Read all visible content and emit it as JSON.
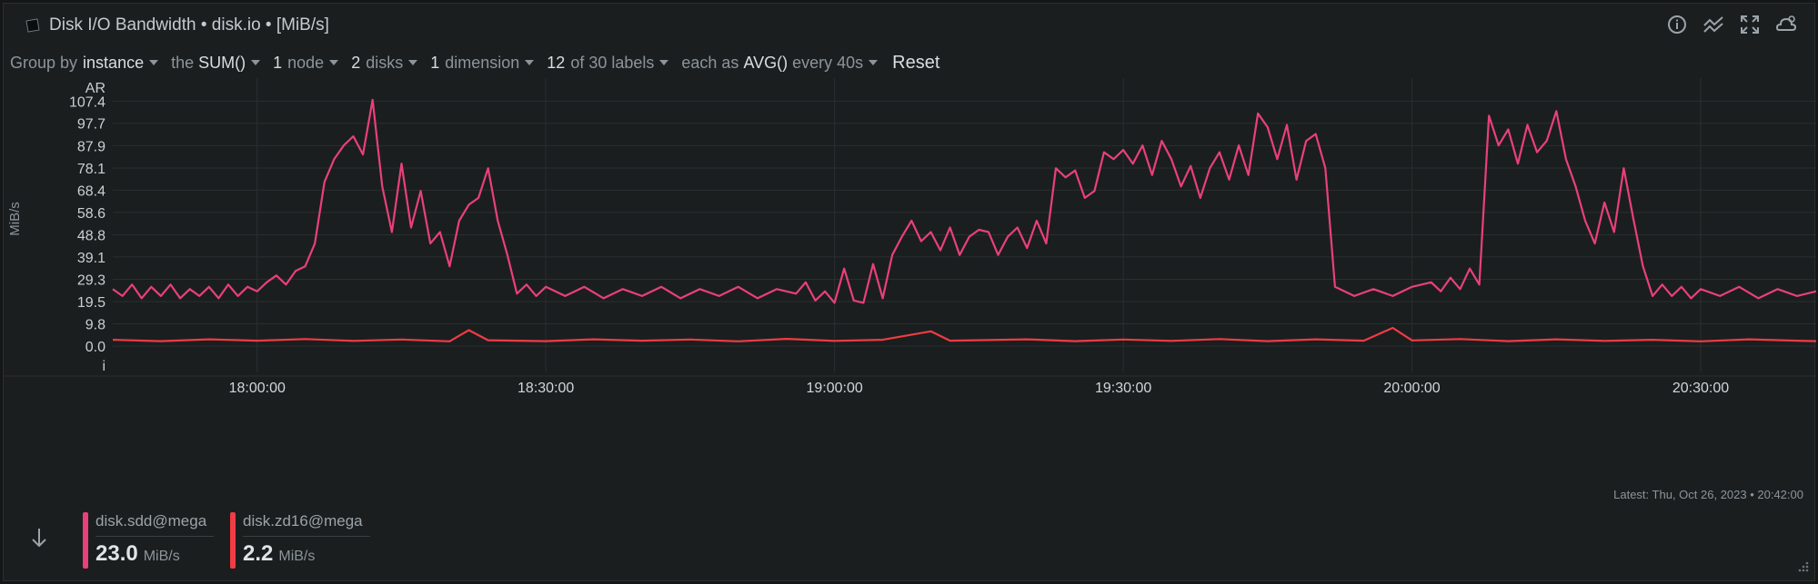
{
  "header": {
    "title": "Disk I/O Bandwidth • disk.io • [MiB/s]",
    "icons": [
      "hdd-icon",
      "info-icon",
      "chart-type-icon",
      "fullscreen-icon",
      "alert-icon"
    ]
  },
  "controls": {
    "group_by_label": "Group by",
    "group_by_value": "instance",
    "the_label": "the",
    "aggregate": "SUM()",
    "nodes_count": "1",
    "nodes_label": "node",
    "disks_count": "2",
    "disks_label": "disks",
    "dimension_count": "1",
    "dimension_label": "dimension",
    "labels_count": "12",
    "labels_of": "of 30 labels",
    "each_as_label": "each as",
    "each_as_value": "AVG()",
    "every": "every 40s",
    "reset": "Reset"
  },
  "chart_data": {
    "type": "line",
    "ylabel": "MiB/s",
    "yticks": [
      "107.4",
      "97.7",
      "87.9",
      "78.1",
      "68.4",
      "58.6",
      "48.8",
      "39.1",
      "29.3",
      "19.5",
      "9.8",
      "0.0"
    ],
    "ytop_label": "AR",
    "ybottom_label": "i",
    "ylim": [
      -11.5,
      117.5
    ],
    "xlim": [
      "17:45:00",
      "20:42:00"
    ],
    "xticks": [
      "18:00:00",
      "18:30:00",
      "19:00:00",
      "19:30:00",
      "20:00:00",
      "20:30:00"
    ],
    "grid": true,
    "series": [
      {
        "name": "disk.sdd@mega",
        "color": "#e9407a",
        "points": [
          [
            "17:45:00",
            25
          ],
          [
            "17:46:00",
            22
          ],
          [
            "17:47:00",
            27
          ],
          [
            "17:48:00",
            21
          ],
          [
            "17:49:00",
            26
          ],
          [
            "17:50:00",
            22
          ],
          [
            "17:51:00",
            27
          ],
          [
            "17:52:00",
            21
          ],
          [
            "17:53:00",
            25
          ],
          [
            "17:54:00",
            22
          ],
          [
            "17:55:00",
            26
          ],
          [
            "17:56:00",
            21
          ],
          [
            "17:57:00",
            27
          ],
          [
            "17:58:00",
            22
          ],
          [
            "17:59:00",
            26
          ],
          [
            "18:00:00",
            24
          ],
          [
            "18:01:00",
            28
          ],
          [
            "18:02:00",
            31
          ],
          [
            "18:03:00",
            27
          ],
          [
            "18:04:00",
            33
          ],
          [
            "18:05:00",
            35
          ],
          [
            "18:06:00",
            45
          ],
          [
            "18:07:00",
            72
          ],
          [
            "18:08:00",
            82
          ],
          [
            "18:09:00",
            88
          ],
          [
            "18:10:00",
            92
          ],
          [
            "18:11:00",
            84
          ],
          [
            "18:12:00",
            108
          ],
          [
            "18:13:00",
            70
          ],
          [
            "18:14:00",
            50
          ],
          [
            "18:15:00",
            80
          ],
          [
            "18:16:00",
            52
          ],
          [
            "18:17:00",
            68
          ],
          [
            "18:18:00",
            45
          ],
          [
            "18:19:00",
            50
          ],
          [
            "18:20:00",
            35
          ],
          [
            "18:21:00",
            55
          ],
          [
            "18:22:00",
            62
          ],
          [
            "18:23:00",
            65
          ],
          [
            "18:24:00",
            78
          ],
          [
            "18:25:00",
            55
          ],
          [
            "18:26:00",
            40
          ],
          [
            "18:27:00",
            23
          ],
          [
            "18:28:00",
            27
          ],
          [
            "18:29:00",
            22
          ],
          [
            "18:30:00",
            26
          ],
          [
            "18:32:00",
            22
          ],
          [
            "18:34:00",
            26
          ],
          [
            "18:36:00",
            21
          ],
          [
            "18:38:00",
            25
          ],
          [
            "18:40:00",
            22
          ],
          [
            "18:42:00",
            26
          ],
          [
            "18:44:00",
            21
          ],
          [
            "18:46:00",
            25
          ],
          [
            "18:48:00",
            22
          ],
          [
            "18:50:00",
            26
          ],
          [
            "18:52:00",
            21
          ],
          [
            "18:54:00",
            25
          ],
          [
            "18:56:00",
            23
          ],
          [
            "18:57:00",
            28
          ],
          [
            "18:58:00",
            20
          ],
          [
            "18:59:00",
            24
          ],
          [
            "19:00:00",
            19
          ],
          [
            "19:01:00",
            34
          ],
          [
            "19:02:00",
            20
          ],
          [
            "19:03:00",
            19
          ],
          [
            "19:04:00",
            36
          ],
          [
            "19:05:00",
            21
          ],
          [
            "19:06:00",
            40
          ],
          [
            "19:07:00",
            48
          ],
          [
            "19:08:00",
            55
          ],
          [
            "19:09:00",
            46
          ],
          [
            "19:10:00",
            50
          ],
          [
            "19:11:00",
            42
          ],
          [
            "19:12:00",
            52
          ],
          [
            "19:13:00",
            40
          ],
          [
            "19:14:00",
            48
          ],
          [
            "19:15:00",
            51
          ],
          [
            "19:16:00",
            50
          ],
          [
            "19:17:00",
            40
          ],
          [
            "19:18:00",
            48
          ],
          [
            "19:19:00",
            52
          ],
          [
            "19:20:00",
            43
          ],
          [
            "19:21:00",
            55
          ],
          [
            "19:22:00",
            45
          ],
          [
            "19:23:00",
            78
          ],
          [
            "19:24:00",
            74
          ],
          [
            "19:25:00",
            77
          ],
          [
            "19:26:00",
            65
          ],
          [
            "19:27:00",
            68
          ],
          [
            "19:28:00",
            85
          ],
          [
            "19:29:00",
            82
          ],
          [
            "19:30:00",
            86
          ],
          [
            "19:31:00",
            80
          ],
          [
            "19:32:00",
            88
          ],
          [
            "19:33:00",
            75
          ],
          [
            "19:34:00",
            90
          ],
          [
            "19:35:00",
            82
          ],
          [
            "19:36:00",
            70
          ],
          [
            "19:37:00",
            79
          ],
          [
            "19:38:00",
            65
          ],
          [
            "19:39:00",
            78
          ],
          [
            "19:40:00",
            85
          ],
          [
            "19:41:00",
            73
          ],
          [
            "19:42:00",
            88
          ],
          [
            "19:43:00",
            75
          ],
          [
            "19:44:00",
            102
          ],
          [
            "19:45:00",
            96
          ],
          [
            "19:46:00",
            82
          ],
          [
            "19:47:00",
            97
          ],
          [
            "19:48:00",
            73
          ],
          [
            "19:49:00",
            90
          ],
          [
            "19:50:00",
            93
          ],
          [
            "19:51:00",
            78
          ],
          [
            "19:52:00",
            26
          ],
          [
            "19:54:00",
            22
          ],
          [
            "19:56:00",
            25
          ],
          [
            "19:58:00",
            22
          ],
          [
            "20:00:00",
            26
          ],
          [
            "20:02:00",
            28
          ],
          [
            "20:03:00",
            24
          ],
          [
            "20:04:00",
            30
          ],
          [
            "20:05:00",
            25
          ],
          [
            "20:06:00",
            34
          ],
          [
            "20:07:00",
            27
          ],
          [
            "20:08:00",
            101
          ],
          [
            "20:09:00",
            88
          ],
          [
            "20:10:00",
            95
          ],
          [
            "20:11:00",
            80
          ],
          [
            "20:12:00",
            97
          ],
          [
            "20:13:00",
            85
          ],
          [
            "20:14:00",
            90
          ],
          [
            "20:15:00",
            103
          ],
          [
            "20:16:00",
            82
          ],
          [
            "20:17:00",
            70
          ],
          [
            "20:18:00",
            55
          ],
          [
            "20:19:00",
            45
          ],
          [
            "20:20:00",
            63
          ],
          [
            "20:21:00",
            50
          ],
          [
            "20:22:00",
            78
          ],
          [
            "20:23:00",
            56
          ],
          [
            "20:24:00",
            35
          ],
          [
            "20:25:00",
            22
          ],
          [
            "20:26:00",
            27
          ],
          [
            "20:27:00",
            22
          ],
          [
            "20:28:00",
            26
          ],
          [
            "20:29:00",
            21
          ],
          [
            "20:30:00",
            25
          ],
          [
            "20:32:00",
            22
          ],
          [
            "20:34:00",
            26
          ],
          [
            "20:36:00",
            21
          ],
          [
            "20:38:00",
            25
          ],
          [
            "20:40:00",
            22
          ],
          [
            "20:42:00",
            24
          ]
        ]
      },
      {
        "name": "disk.zd16@mega",
        "color": "#f03c44",
        "points": [
          [
            "17:45:00",
            2.8
          ],
          [
            "17:50:00",
            2.2
          ],
          [
            "17:55:00",
            3.0
          ],
          [
            "18:00:00",
            2.4
          ],
          [
            "18:05:00",
            3.1
          ],
          [
            "18:10:00",
            2.3
          ],
          [
            "18:15:00",
            2.9
          ],
          [
            "18:20:00",
            2.1
          ],
          [
            "18:22:00",
            7.0
          ],
          [
            "18:24:00",
            2.6
          ],
          [
            "18:30:00",
            2.2
          ],
          [
            "18:35:00",
            3.0
          ],
          [
            "18:40:00",
            2.4
          ],
          [
            "18:45:00",
            2.9
          ],
          [
            "18:50:00",
            2.1
          ],
          [
            "18:55:00",
            3.2
          ],
          [
            "19:00:00",
            2.3
          ],
          [
            "19:05:00",
            2.8
          ],
          [
            "19:10:00",
            6.5
          ],
          [
            "19:12:00",
            2.4
          ],
          [
            "19:20:00",
            3.0
          ],
          [
            "19:25:00",
            2.2
          ],
          [
            "19:30:00",
            2.9
          ],
          [
            "19:35:00",
            2.3
          ],
          [
            "19:40:00",
            3.1
          ],
          [
            "19:45:00",
            2.2
          ],
          [
            "19:50:00",
            3.0
          ],
          [
            "19:55:00",
            2.4
          ],
          [
            "19:58:00",
            8.0
          ],
          [
            "20:00:00",
            2.5
          ],
          [
            "20:05:00",
            3.1
          ],
          [
            "20:10:00",
            2.2
          ],
          [
            "20:15:00",
            3.0
          ],
          [
            "20:20:00",
            2.3
          ],
          [
            "20:25:00",
            2.8
          ],
          [
            "20:30:00",
            2.1
          ],
          [
            "20:35:00",
            3.0
          ],
          [
            "20:40:00",
            2.4
          ],
          [
            "20:42:00",
            2.2
          ]
        ]
      }
    ]
  },
  "footer": {
    "latest_label": "Latest:",
    "latest_value": "Thu, Oct 26, 2023 • 20:42:00",
    "legend": [
      {
        "name": "disk.sdd@mega",
        "value": "23.0",
        "unit": "MiB/s",
        "color": "#e9407a"
      },
      {
        "name": "disk.zd16@mega",
        "value": "2.2",
        "unit": "MiB/s",
        "color": "#f03c44"
      }
    ]
  }
}
